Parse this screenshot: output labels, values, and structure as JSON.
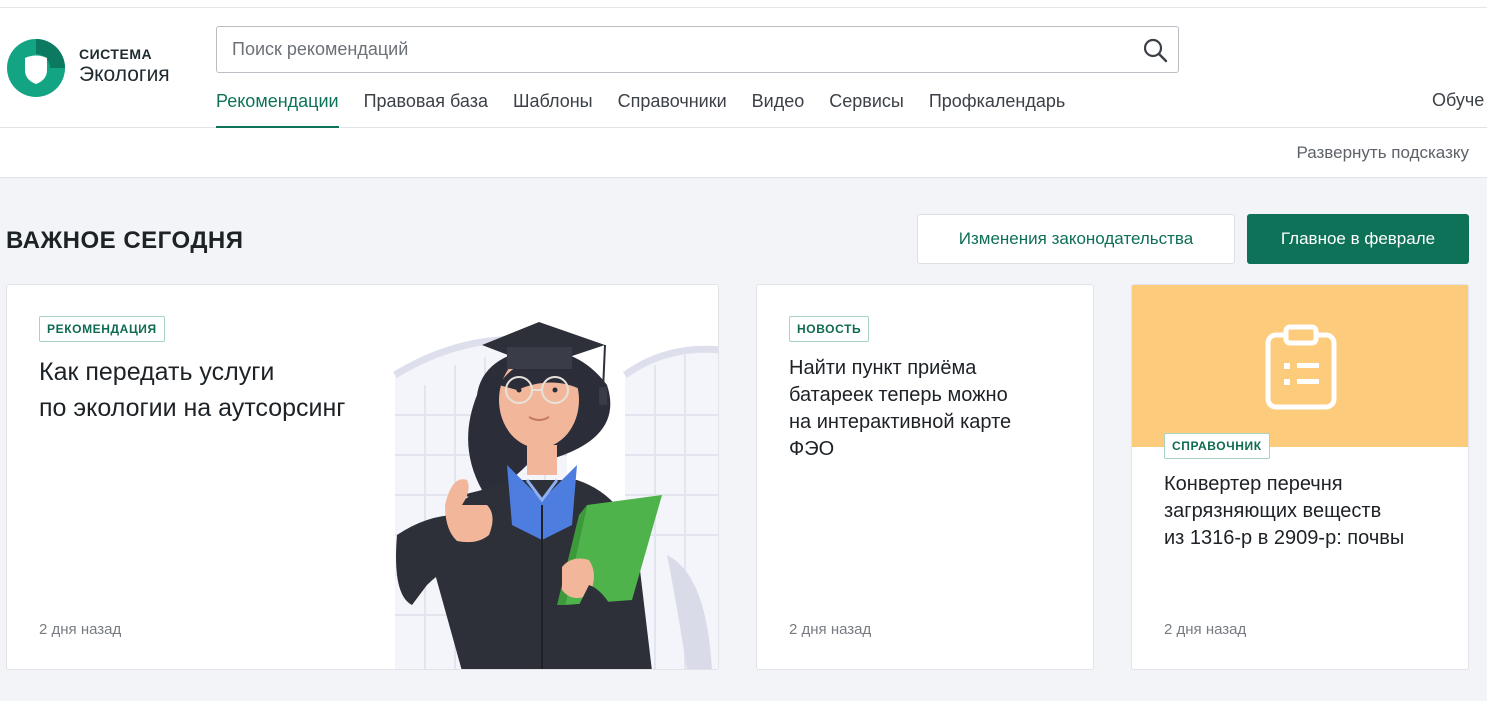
{
  "logo": {
    "line1": "СИСТЕМА",
    "line2": "Экология"
  },
  "search": {
    "placeholder": "Поиск рекомендаций",
    "value": ""
  },
  "nav": {
    "items": [
      {
        "label": "Рекомендации",
        "active": true
      },
      {
        "label": "Правовая база",
        "active": false
      },
      {
        "label": "Шаблоны",
        "active": false
      },
      {
        "label": "Справочники",
        "active": false
      },
      {
        "label": "Видео",
        "active": false
      },
      {
        "label": "Сервисы",
        "active": false
      },
      {
        "label": "Профкалендарь",
        "active": false
      }
    ],
    "right_label": "Обуче"
  },
  "hint": {
    "label": "Развернуть подсказку"
  },
  "section": {
    "title": "ВАЖНОЕ СЕГОДНЯ",
    "btn_changes": "Изменения законодательства",
    "btn_main": "Главное в феврале"
  },
  "cards": [
    {
      "badge": "РЕКОМЕНДАЦИЯ",
      "title_line1": "Как передать услуги",
      "title_line2": "по экологии на аутсорсинг",
      "date": "2 дня назад"
    },
    {
      "badge": "НОВОСТЬ",
      "title_lines": [
        "Найти пункт приёма",
        "батареек теперь можно",
        "на интерактивной карте",
        "ФЭО"
      ],
      "date": "2 дня назад"
    },
    {
      "badge": "СПРАВОЧНИК",
      "title_lines": [
        "Конвертер перечня",
        "загрязняющих веществ",
        "из 1316-р в 2909-р: почвы"
      ],
      "date": "2 дня назад"
    }
  ],
  "colors": {
    "brand": "#0e7259",
    "card_highlight": "#fdcb7c",
    "illustration_book": "#4db34a"
  }
}
